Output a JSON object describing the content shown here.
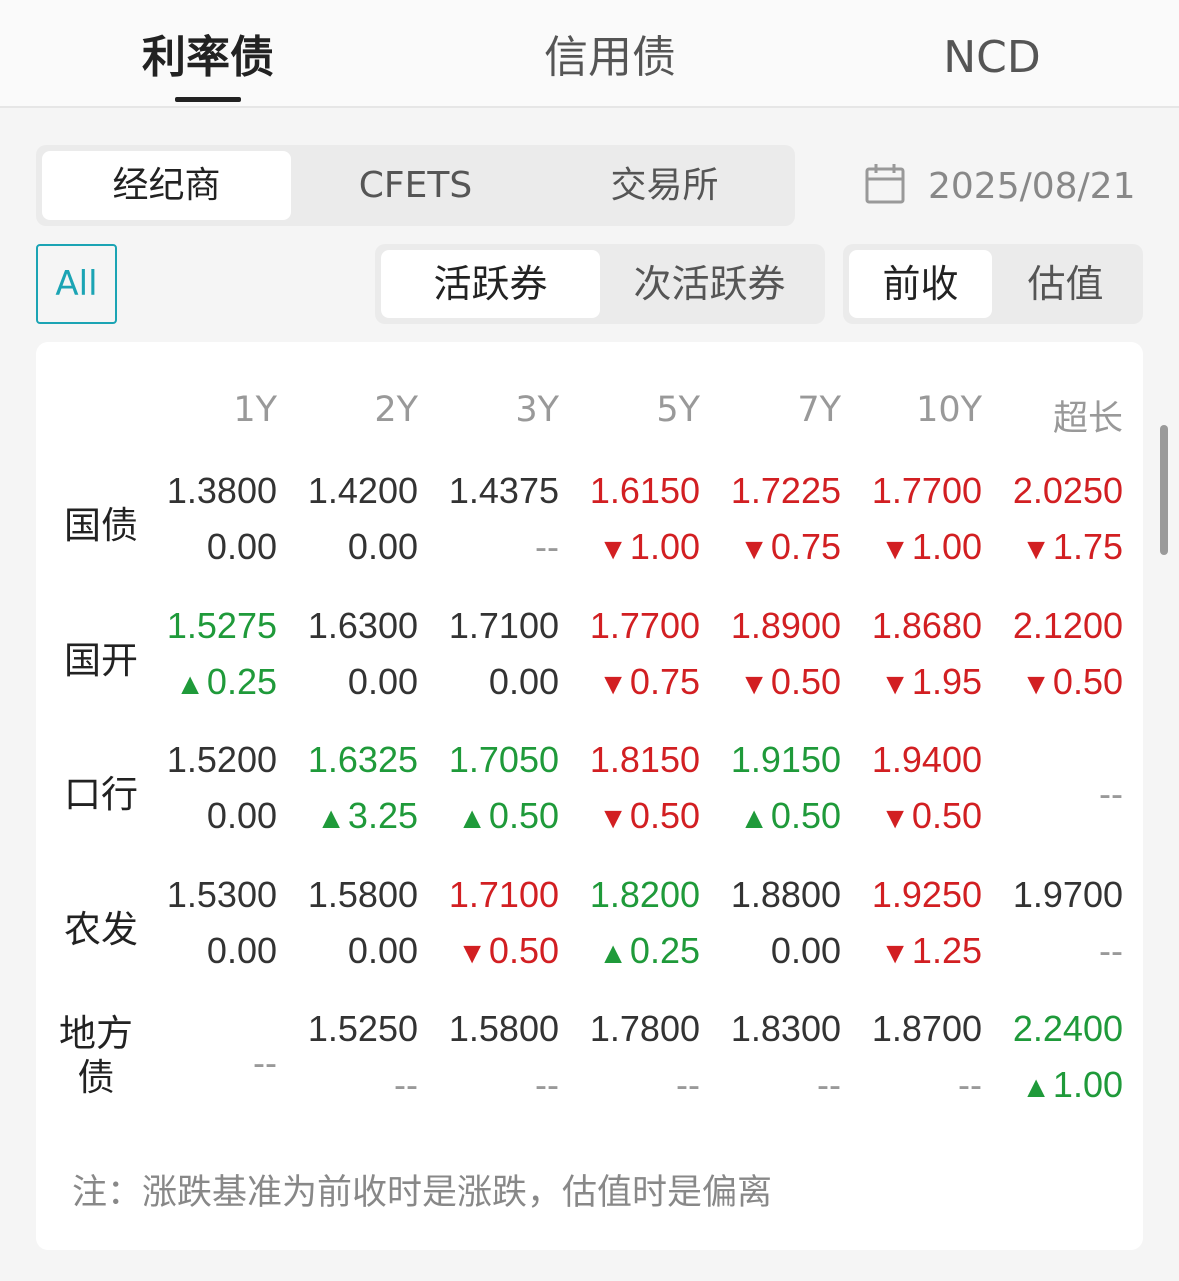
{
  "top_tabs": [
    {
      "label": "利率债",
      "active": true
    },
    {
      "label": "信用债",
      "active": false
    },
    {
      "label": "NCD",
      "active": false
    }
  ],
  "source_tabs": [
    {
      "label": "经纪商",
      "active": true
    },
    {
      "label": "CFETS",
      "active": false
    },
    {
      "label": "交易所",
      "active": false
    }
  ],
  "date": {
    "icon": "calendar-icon",
    "value": "2025/08/21"
  },
  "all_button": {
    "label": "All"
  },
  "activity_tabs": [
    {
      "label": "活跃券",
      "active": true
    },
    {
      "label": "次活跃券",
      "active": false
    }
  ],
  "basis_tabs": [
    {
      "label": "前收",
      "active": true
    },
    {
      "label": "估值",
      "active": false
    }
  ],
  "colors": {
    "up": "#d21f22",
    "down": "#1f9a3a",
    "accent": "#1ba4b4"
  },
  "table": {
    "columns": [
      "1Y",
      "2Y",
      "3Y",
      "5Y",
      "7Y",
      "10Y",
      "超长"
    ],
    "rows": [
      {
        "label": "国债",
        "cells": [
          {
            "value": "1.3800",
            "value_color": "neutral",
            "change": "0.00",
            "dir": "none"
          },
          {
            "value": "1.4200",
            "value_color": "neutral",
            "change": "0.00",
            "dir": "none"
          },
          {
            "value": "1.4375",
            "value_color": "neutral",
            "change": "--",
            "dir": "none"
          },
          {
            "value": "1.6150",
            "value_color": "red",
            "change": "1.00",
            "dir": "down-red"
          },
          {
            "value": "1.7225",
            "value_color": "red",
            "change": "0.75",
            "dir": "down-red"
          },
          {
            "value": "1.7700",
            "value_color": "red",
            "change": "1.00",
            "dir": "down-red"
          },
          {
            "value": "2.0250",
            "value_color": "red",
            "change": "1.75",
            "dir": "down-red"
          }
        ]
      },
      {
        "label": "国开",
        "cells": [
          {
            "value": "1.5275",
            "value_color": "green",
            "change": "0.25",
            "dir": "up-green"
          },
          {
            "value": "1.6300",
            "value_color": "neutral",
            "change": "0.00",
            "dir": "none"
          },
          {
            "value": "1.7100",
            "value_color": "neutral",
            "change": "0.00",
            "dir": "none"
          },
          {
            "value": "1.7700",
            "value_color": "red",
            "change": "0.75",
            "dir": "down-red"
          },
          {
            "value": "1.8900",
            "value_color": "red",
            "change": "0.50",
            "dir": "down-red"
          },
          {
            "value": "1.8680",
            "value_color": "red",
            "change": "1.95",
            "dir": "down-red"
          },
          {
            "value": "2.1200",
            "value_color": "red",
            "change": "0.50",
            "dir": "down-red"
          }
        ]
      },
      {
        "label": "口行",
        "cells": [
          {
            "value": "1.5200",
            "value_color": "neutral",
            "change": "0.00",
            "dir": "none"
          },
          {
            "value": "1.6325",
            "value_color": "green",
            "change": "3.25",
            "dir": "up-green"
          },
          {
            "value": "1.7050",
            "value_color": "green",
            "change": "0.50",
            "dir": "up-green"
          },
          {
            "value": "1.8150",
            "value_color": "red",
            "change": "0.50",
            "dir": "down-red"
          },
          {
            "value": "1.9150",
            "value_color": "green",
            "change": "0.50",
            "dir": "up-green"
          },
          {
            "value": "1.9400",
            "value_color": "red",
            "change": "0.50",
            "dir": "down-red"
          },
          {
            "empty": "--"
          }
        ]
      },
      {
        "label": "农发",
        "cells": [
          {
            "value": "1.5300",
            "value_color": "neutral",
            "change": "0.00",
            "dir": "none"
          },
          {
            "value": "1.5800",
            "value_color": "neutral",
            "change": "0.00",
            "dir": "none"
          },
          {
            "value": "1.7100",
            "value_color": "red",
            "change": "0.50",
            "dir": "down-red"
          },
          {
            "value": "1.8200",
            "value_color": "green",
            "change": "0.25",
            "dir": "up-green"
          },
          {
            "value": "1.8800",
            "value_color": "neutral",
            "change": "0.00",
            "dir": "none"
          },
          {
            "value": "1.9250",
            "value_color": "red",
            "change": "1.25",
            "dir": "down-red"
          },
          {
            "value": "1.9700",
            "value_color": "neutral",
            "change": "--",
            "dir": "none"
          }
        ]
      },
      {
        "label": "地方债",
        "cells": [
          {
            "empty": "--"
          },
          {
            "value": "1.5250",
            "value_color": "neutral",
            "change": "--",
            "dir": "none"
          },
          {
            "value": "1.5800",
            "value_color": "neutral",
            "change": "--",
            "dir": "none"
          },
          {
            "value": "1.7800",
            "value_color": "neutral",
            "change": "--",
            "dir": "none"
          },
          {
            "value": "1.8300",
            "value_color": "neutral",
            "change": "--",
            "dir": "none"
          },
          {
            "value": "1.8700",
            "value_color": "neutral",
            "change": "--",
            "dir": "none"
          },
          {
            "value": "2.2400",
            "value_color": "green",
            "change": "1.00",
            "dir": "up-green"
          }
        ]
      }
    ]
  },
  "note": "注：涨跌基准为前收时是涨跌，估值时是偏离"
}
